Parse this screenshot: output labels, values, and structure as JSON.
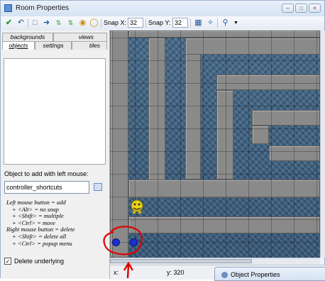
{
  "window": {
    "title": "Room Properties",
    "controls": [
      "minimize-icon",
      "maximize-icon",
      "close-icon"
    ]
  },
  "toolbar": {
    "snap_x_label": "Snap X:",
    "snap_x_value": "32",
    "snap_y_label": "Snap Y:",
    "snap_y_value": "32"
  },
  "tabs": {
    "row1": [
      "backgrounds",
      "views"
    ],
    "row2": [
      "objects",
      "settings",
      "tiles"
    ],
    "active": "objects"
  },
  "object_panel": {
    "label": "Object to add with left mouse:",
    "selected_object": "controller_shortcuts"
  },
  "help_lines": [
    "Left mouse button = add",
    "+ <Alt> = no snap",
    "+ <Shift> = multiple",
    "+ <Ctrl> = move",
    "Right mouse button = delete",
    "+ <Shift> = delete all",
    "+ <Ctrl> = popup menu"
  ],
  "delete_underlying": {
    "label": "Delete underlying",
    "checked": true
  },
  "status": {
    "x_label": "x:",
    "x_value": "",
    "y_label": "y:",
    "y_value": "320"
  },
  "popup_window": {
    "title": "Object Properties"
  },
  "colors": {
    "annotation": "#e00000",
    "wall": "#8a8a8a",
    "water": "#3b5874"
  }
}
